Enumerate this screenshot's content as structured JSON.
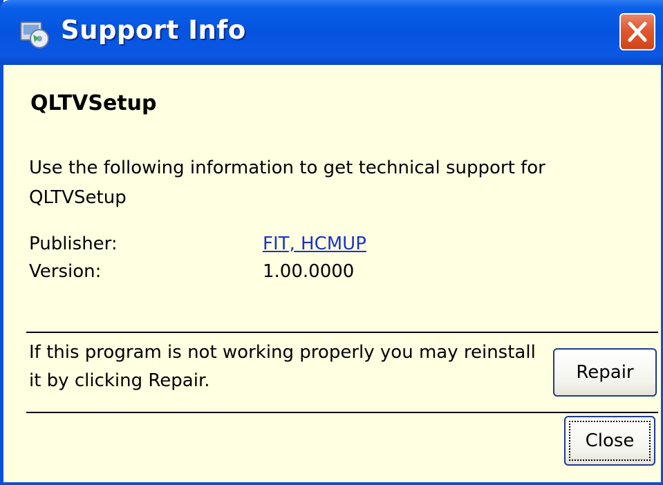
{
  "window": {
    "title": "Support Info",
    "icons": {
      "title_icon": "installer-icon",
      "close_icon": "close-icon"
    },
    "colors": {
      "titlebar": "#0553df",
      "body": "#ffffe1",
      "close_button": "#e0582f",
      "link": "#1a33c7"
    }
  },
  "content": {
    "app_name": "QLTVSetup",
    "intro_text": "Use the following information to get technical support for QLTVSetup",
    "publisher_label": "Publisher:",
    "publisher_value": "FIT, HCMUP",
    "version_label": "Version:",
    "version_value": "1.00.0000",
    "repair_text": "If this program is not working properly you may reinstall it by clicking Repair."
  },
  "buttons": {
    "repair_label": "Repair",
    "close_label": "Close"
  }
}
